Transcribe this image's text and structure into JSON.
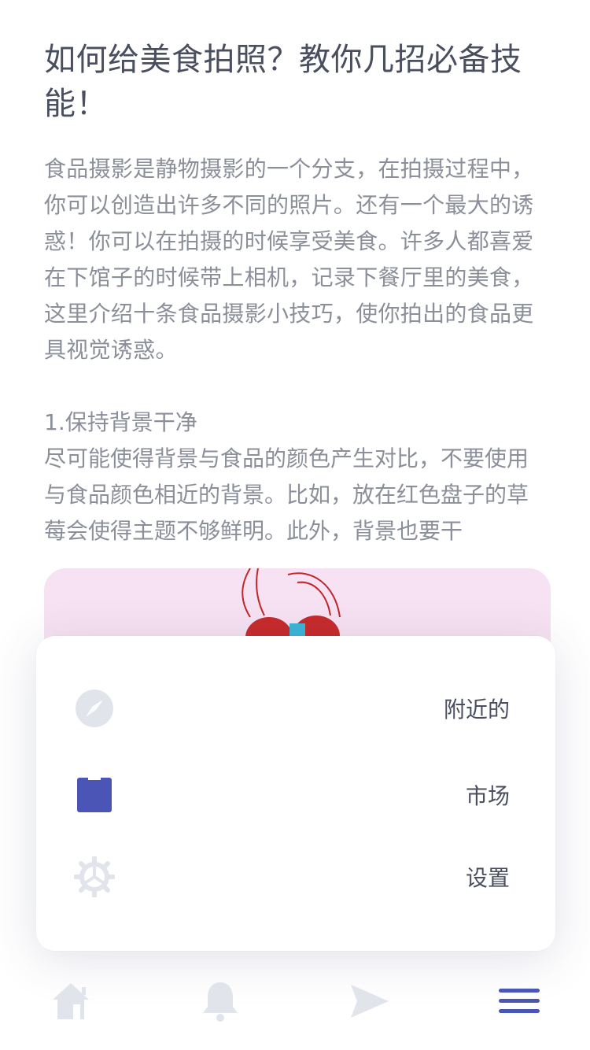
{
  "article": {
    "title": "如何给美食拍照？教你几招必备技能！",
    "intro": "食品摄影是静物摄影的一个分支，在拍摄过程中，你可以创造出许多不同的照片。还有一个最大的诱惑！你可以在拍摄的时候享受美食。许多人都喜爱在下馆子的时候带上相机，记录下餐厅里的美食，这里介绍十条食品摄影小技巧，使你拍出的食品更具视觉诱惑。",
    "section1_title": "1.保持背景干净",
    "section1_body": "尽可能使得背景与食品的颜色产生对比，不要使用与食品颜色相近的背景。比如，放在红色盘子的草莓会使得主题不够鲜明。此外，背景也要干"
  },
  "menu": {
    "items": [
      {
        "label": "附近的",
        "icon": "compass-icon"
      },
      {
        "label": "市场",
        "icon": "shopping-bag-icon"
      },
      {
        "label": "设置",
        "icon": "gear-icon"
      }
    ]
  },
  "tabbar": {
    "tabs": [
      {
        "icon": "home-icon"
      },
      {
        "icon": "bell-icon"
      },
      {
        "icon": "send-icon"
      },
      {
        "icon": "menu-icon",
        "active": true
      }
    ]
  },
  "colors": {
    "accent": "#4a55b5",
    "icon_inactive": "#e1e4ea",
    "photo_bg": "#f6e2f2"
  }
}
